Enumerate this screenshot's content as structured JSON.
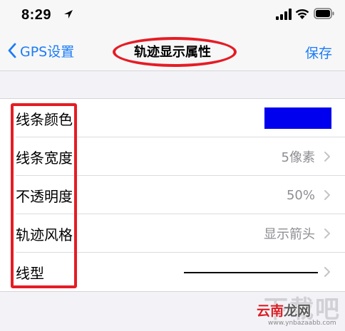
{
  "status_bar": {
    "time": "8:29",
    "icons": [
      "location-arrow-icon",
      "cellular-signal-icon",
      "wifi-icon",
      "battery-icon"
    ]
  },
  "nav": {
    "back_label": "GPS设置",
    "title": "轨迹显示属性",
    "save_label": "保存"
  },
  "rows": [
    {
      "label": "线条颜色",
      "value": "",
      "swatch_color": "#0000ee"
    },
    {
      "label": "线条宽度",
      "value": "5像素"
    },
    {
      "label": "不透明度",
      "value": "50%"
    },
    {
      "label": "轨迹风格",
      "value": "显示箭头"
    },
    {
      "label": "线型",
      "value": ""
    }
  ],
  "colors": {
    "accent": "#1b7cf5",
    "annotation": "#e51c24",
    "swatch": "#0000ee"
  },
  "watermark": {
    "brand_part1": "云南",
    "brand_part2": "龙网",
    "url": "www.ynbazaabb.com"
  }
}
